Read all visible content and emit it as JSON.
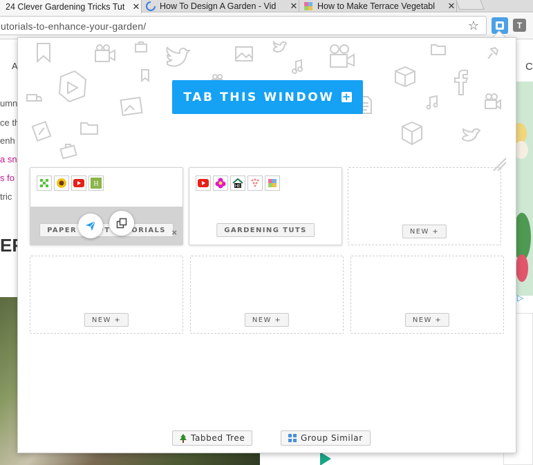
{
  "browser": {
    "tabs": [
      {
        "title": "24 Clever Gardening Tricks Tut",
        "active": true
      },
      {
        "title": "How To Design A Garden - Vid",
        "active": false
      },
      {
        "title": "How to Make Terrace Vegetabl",
        "active": false
      }
    ],
    "close_glyph": "✕",
    "url": "utorials-to-enhance-your-garden/",
    "bookmark_icon": "star-icon",
    "extension_t_label": "T"
  },
  "background_page": {
    "nav_left": "A",
    "nav_right": "C",
    "snippets": [
      {
        "text": "umn",
        "pink": false
      },
      {
        "text": "ce th",
        "pink": false
      },
      {
        "text": " enh",
        "pink": false
      },
      {
        "text": "a sn",
        "pink": true
      },
      {
        "text": "s fo",
        "pink": true
      },
      {
        "text": " tric",
        "pink": false
      }
    ],
    "heading": "ER"
  },
  "popup": {
    "tab_window_label": "TAB THIS WINDOW",
    "tab_window_icon": "plus-square-icon",
    "groups": [
      {
        "label": "PAPER CRAFT TUTORIALS",
        "favicons": [
          "green-pixel-favicon",
          "sunflower-favicon",
          "youtube-favicon",
          "h-letter-favicon"
        ],
        "hovered": true
      },
      {
        "label": "GARDENING TUTS",
        "favicons": [
          "youtube-favicon",
          "pink-flower-favicon",
          "house-favicon",
          "dots-favicon",
          "pinwheel-favicon"
        ],
        "hovered": false
      }
    ],
    "empty_slot_label": "NEW +",
    "close_glyph": "×",
    "footer": {
      "tree_label": "Tabbed Tree",
      "similar_label": "Group Similar"
    }
  }
}
